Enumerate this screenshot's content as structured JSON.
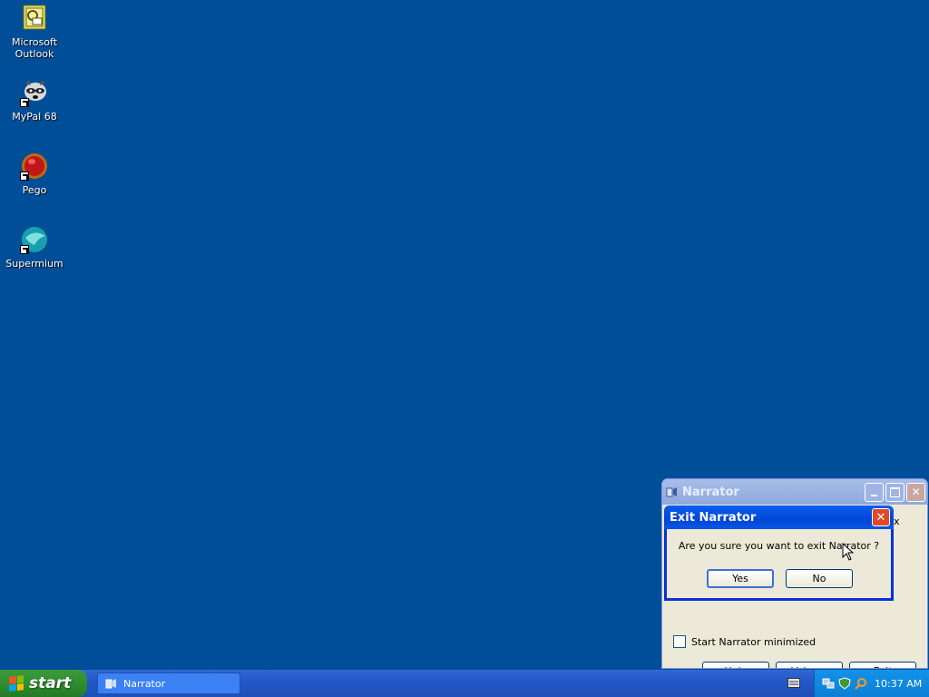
{
  "desktop": {
    "icons": [
      {
        "label": "Microsoft Outlook",
        "icon": "outlook-icon"
      },
      {
        "label": "MyPal 68",
        "icon": "mypal-raccoon-icon"
      },
      {
        "label": "Pego",
        "icon": "pego-red-sphere-icon"
      },
      {
        "label": "Supermium",
        "icon": "supermium-globe-icon"
      }
    ]
  },
  "narrator_window": {
    "title": "Narrator",
    "start_minimized_label": "Start Narrator minimized",
    "start_minimized_checked": false,
    "buttons": {
      "help": "Help",
      "voice": "Voice...",
      "exit": "Exit"
    },
    "partial_text": "x"
  },
  "exit_dialog": {
    "title": "Exit Narrator",
    "message": "Are you sure you want to exit Narrator ?",
    "yes": "Yes",
    "no": "No"
  },
  "taskbar": {
    "start_label": "start",
    "task_button": "Narrator",
    "clock": "10:37 AM"
  },
  "colors": {
    "desktop": "#004e98",
    "dialog_title": "#0046d5",
    "start_green": "#2f8a2f",
    "taskbar_blue": "#2458c8"
  }
}
